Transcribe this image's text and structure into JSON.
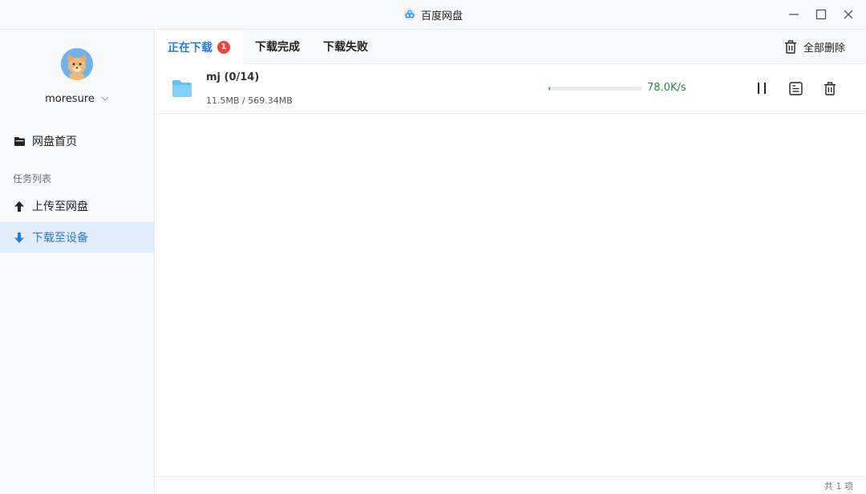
{
  "window": {
    "title": "百度网盘",
    "controls": [
      "minimize",
      "maximize",
      "close"
    ]
  },
  "sidebar": {
    "username": "moresure",
    "items": [
      {
        "label": "网盘首页",
        "icon": "folder-icon"
      },
      {
        "label": "上传至网盘",
        "icon": "upload-arrow-icon"
      },
      {
        "label": "下载至设备",
        "icon": "download-arrow-icon",
        "active": true
      }
    ],
    "section_label": "任务列表"
  },
  "tabs": [
    {
      "label": "正在下载",
      "badge": "1",
      "active": true
    },
    {
      "label": "下载完成"
    },
    {
      "label": "下载失败"
    }
  ],
  "toolbar": {
    "delete_all": "全部删除"
  },
  "tasks": [
    {
      "name": "mj (0/14)",
      "size": "11.5MB / 569.34MB",
      "progress_fraction": 0.02,
      "speed": "78.0K/s"
    }
  ],
  "footer": {
    "count": "共 1 项"
  },
  "colors": {
    "accent": "#2979e4",
    "progress": "#22b24c",
    "badge": "#f0433a",
    "speed": "#1f8f3d"
  }
}
